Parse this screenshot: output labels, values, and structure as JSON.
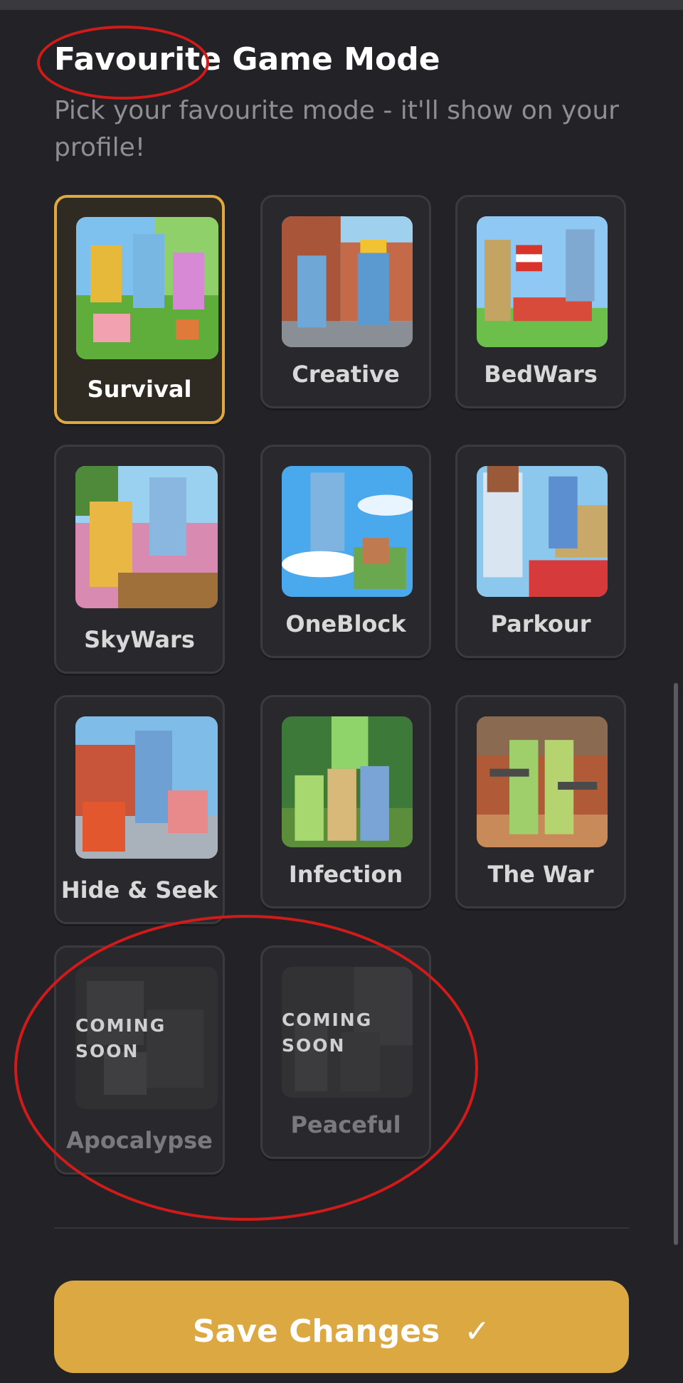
{
  "header": {
    "title": "Favourite Game Mode",
    "subtitle": "Pick your favourite mode - it'll show on your profile!"
  },
  "modes": [
    {
      "label": "Survival",
      "state": "selected",
      "icon": "survival-thumbnail"
    },
    {
      "label": "Creative",
      "state": "available",
      "icon": "creative-thumbnail"
    },
    {
      "label": "BedWars",
      "state": "available",
      "icon": "bedwars-thumbnail"
    },
    {
      "label": "SkyWars",
      "state": "available",
      "icon": "skywars-thumbnail"
    },
    {
      "label": "OneBlock",
      "state": "available",
      "icon": "oneblock-thumbnail"
    },
    {
      "label": "Parkour",
      "state": "available",
      "icon": "parkour-thumbnail"
    },
    {
      "label": "Hide & Seek",
      "state": "available",
      "icon": "hide-and-seek-thumbnail"
    },
    {
      "label": "Infection",
      "state": "available",
      "icon": "infection-thumbnail"
    },
    {
      "label": "The War",
      "state": "available",
      "icon": "the-war-thumbnail"
    },
    {
      "label": "Apocalypse",
      "state": "coming-soon",
      "badge": "COMING SOON",
      "icon": "apocalypse-thumbnail"
    },
    {
      "label": "Peaceful",
      "state": "coming-soon",
      "badge": "COMING SOON",
      "icon": "peaceful-thumbnail"
    }
  ],
  "save_button": {
    "label": "Save Changes",
    "icon": "check-icon"
  },
  "colors": {
    "background": "#232327",
    "card": "#29292d",
    "accent": "#e0a93e",
    "button": "#dca842",
    "annotation": "#d11a1a"
  }
}
